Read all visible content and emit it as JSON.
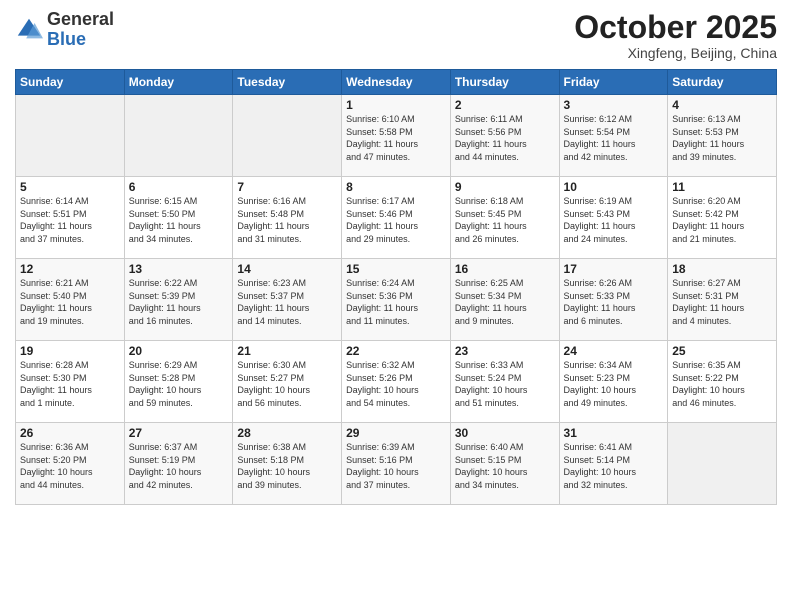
{
  "header": {
    "logo_general": "General",
    "logo_blue": "Blue",
    "month_title": "October 2025",
    "location": "Xingfeng, Beijing, China"
  },
  "weekdays": [
    "Sunday",
    "Monday",
    "Tuesday",
    "Wednesday",
    "Thursday",
    "Friday",
    "Saturday"
  ],
  "weeks": [
    [
      {
        "day": "",
        "info": ""
      },
      {
        "day": "",
        "info": ""
      },
      {
        "day": "",
        "info": ""
      },
      {
        "day": "1",
        "info": "Sunrise: 6:10 AM\nSunset: 5:58 PM\nDaylight: 11 hours\nand 47 minutes."
      },
      {
        "day": "2",
        "info": "Sunrise: 6:11 AM\nSunset: 5:56 PM\nDaylight: 11 hours\nand 44 minutes."
      },
      {
        "day": "3",
        "info": "Sunrise: 6:12 AM\nSunset: 5:54 PM\nDaylight: 11 hours\nand 42 minutes."
      },
      {
        "day": "4",
        "info": "Sunrise: 6:13 AM\nSunset: 5:53 PM\nDaylight: 11 hours\nand 39 minutes."
      }
    ],
    [
      {
        "day": "5",
        "info": "Sunrise: 6:14 AM\nSunset: 5:51 PM\nDaylight: 11 hours\nand 37 minutes."
      },
      {
        "day": "6",
        "info": "Sunrise: 6:15 AM\nSunset: 5:50 PM\nDaylight: 11 hours\nand 34 minutes."
      },
      {
        "day": "7",
        "info": "Sunrise: 6:16 AM\nSunset: 5:48 PM\nDaylight: 11 hours\nand 31 minutes."
      },
      {
        "day": "8",
        "info": "Sunrise: 6:17 AM\nSunset: 5:46 PM\nDaylight: 11 hours\nand 29 minutes."
      },
      {
        "day": "9",
        "info": "Sunrise: 6:18 AM\nSunset: 5:45 PM\nDaylight: 11 hours\nand 26 minutes."
      },
      {
        "day": "10",
        "info": "Sunrise: 6:19 AM\nSunset: 5:43 PM\nDaylight: 11 hours\nand 24 minutes."
      },
      {
        "day": "11",
        "info": "Sunrise: 6:20 AM\nSunset: 5:42 PM\nDaylight: 11 hours\nand 21 minutes."
      }
    ],
    [
      {
        "day": "12",
        "info": "Sunrise: 6:21 AM\nSunset: 5:40 PM\nDaylight: 11 hours\nand 19 minutes."
      },
      {
        "day": "13",
        "info": "Sunrise: 6:22 AM\nSunset: 5:39 PM\nDaylight: 11 hours\nand 16 minutes."
      },
      {
        "day": "14",
        "info": "Sunrise: 6:23 AM\nSunset: 5:37 PM\nDaylight: 11 hours\nand 14 minutes."
      },
      {
        "day": "15",
        "info": "Sunrise: 6:24 AM\nSunset: 5:36 PM\nDaylight: 11 hours\nand 11 minutes."
      },
      {
        "day": "16",
        "info": "Sunrise: 6:25 AM\nSunset: 5:34 PM\nDaylight: 11 hours\nand 9 minutes."
      },
      {
        "day": "17",
        "info": "Sunrise: 6:26 AM\nSunset: 5:33 PM\nDaylight: 11 hours\nand 6 minutes."
      },
      {
        "day": "18",
        "info": "Sunrise: 6:27 AM\nSunset: 5:31 PM\nDaylight: 11 hours\nand 4 minutes."
      }
    ],
    [
      {
        "day": "19",
        "info": "Sunrise: 6:28 AM\nSunset: 5:30 PM\nDaylight: 11 hours\nand 1 minute."
      },
      {
        "day": "20",
        "info": "Sunrise: 6:29 AM\nSunset: 5:28 PM\nDaylight: 10 hours\nand 59 minutes."
      },
      {
        "day": "21",
        "info": "Sunrise: 6:30 AM\nSunset: 5:27 PM\nDaylight: 10 hours\nand 56 minutes."
      },
      {
        "day": "22",
        "info": "Sunrise: 6:32 AM\nSunset: 5:26 PM\nDaylight: 10 hours\nand 54 minutes."
      },
      {
        "day": "23",
        "info": "Sunrise: 6:33 AM\nSunset: 5:24 PM\nDaylight: 10 hours\nand 51 minutes."
      },
      {
        "day": "24",
        "info": "Sunrise: 6:34 AM\nSunset: 5:23 PM\nDaylight: 10 hours\nand 49 minutes."
      },
      {
        "day": "25",
        "info": "Sunrise: 6:35 AM\nSunset: 5:22 PM\nDaylight: 10 hours\nand 46 minutes."
      }
    ],
    [
      {
        "day": "26",
        "info": "Sunrise: 6:36 AM\nSunset: 5:20 PM\nDaylight: 10 hours\nand 44 minutes."
      },
      {
        "day": "27",
        "info": "Sunrise: 6:37 AM\nSunset: 5:19 PM\nDaylight: 10 hours\nand 42 minutes."
      },
      {
        "day": "28",
        "info": "Sunrise: 6:38 AM\nSunset: 5:18 PM\nDaylight: 10 hours\nand 39 minutes."
      },
      {
        "day": "29",
        "info": "Sunrise: 6:39 AM\nSunset: 5:16 PM\nDaylight: 10 hours\nand 37 minutes."
      },
      {
        "day": "30",
        "info": "Sunrise: 6:40 AM\nSunset: 5:15 PM\nDaylight: 10 hours\nand 34 minutes."
      },
      {
        "day": "31",
        "info": "Sunrise: 6:41 AM\nSunset: 5:14 PM\nDaylight: 10 hours\nand 32 minutes."
      },
      {
        "day": "",
        "info": ""
      }
    ]
  ]
}
